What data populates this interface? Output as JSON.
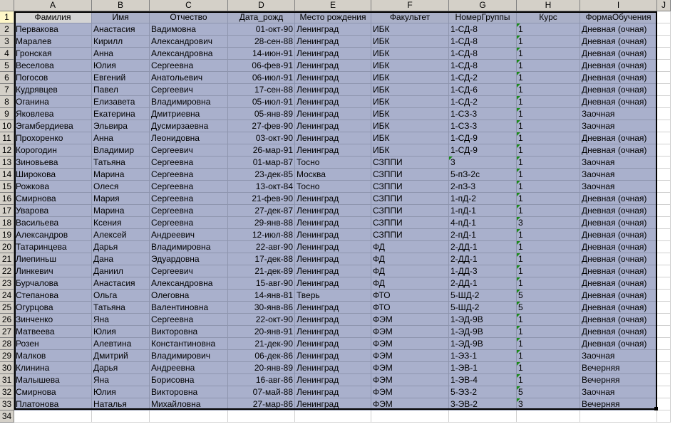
{
  "columns": [
    "A",
    "B",
    "C",
    "D",
    "E",
    "F",
    "G",
    "H",
    "I",
    "J"
  ],
  "headers": [
    "Фамилия",
    "Имя",
    "Отчество",
    "Дата_рожд",
    "Место рождения",
    "Факультет",
    "НомерГруппы",
    "Курс",
    "ФормаОбучения"
  ],
  "row_numbers": [
    "1",
    "2",
    "3",
    "4",
    "5",
    "6",
    "7",
    "8",
    "9",
    "10",
    "11",
    "12",
    "13",
    "14",
    "15",
    "16",
    "17",
    "18",
    "19",
    "20",
    "21",
    "22",
    "23",
    "24",
    "25",
    "26",
    "27",
    "28",
    "29",
    "30",
    "31",
    "32",
    "33",
    "34"
  ],
  "rows": [
    [
      "Первакова",
      "Анастасия",
      "Вадимовна",
      "01-окт-90",
      "Ленинград",
      "ИБК",
      "1-СД-8",
      "1",
      "Дневная (очная)"
    ],
    [
      "Маралев",
      "Кирилл",
      "Александрович",
      "28-сен-88",
      "Ленинград",
      "ИБК",
      "1-СД-8",
      "1",
      "Дневная (очная)"
    ],
    [
      "Гронская",
      "Анна",
      "Александровна",
      "14-июн-91",
      "Ленинград",
      "ИБК",
      "1-СД-8",
      "1",
      "Дневная (очная)"
    ],
    [
      "Веселова",
      "Юлия",
      "Сергеевна",
      "06-фев-91",
      "Ленинград",
      "ИБК",
      "1-СД-8",
      "1",
      "Дневная (очная)"
    ],
    [
      "Погосов",
      "Евгений",
      "Анатольевич",
      "06-июл-91",
      "Ленинград",
      "ИБК",
      "1-СД-2",
      "1",
      "Дневная (очная)"
    ],
    [
      "Кудрявцев",
      "Павел",
      "Сергеевич",
      "17-сен-88",
      "Ленинград",
      "ИБК",
      "1-СД-6",
      "1",
      "Дневная (очная)"
    ],
    [
      "Оганина",
      "Елизавета",
      "Владимировна",
      "05-июл-91",
      "Ленинград",
      "ИБК",
      "1-СД-2",
      "1",
      "Дневная (очная)"
    ],
    [
      "Яковлева",
      "Екатерина",
      "Дмитриевна",
      "05-янв-89",
      "Ленинград",
      "ИБК",
      "1-СЗ-3",
      "1",
      "Заочная"
    ],
    [
      "Эгамбердиева",
      "Эльвира",
      "Дусмирзаевна",
      "27-фев-90",
      "Ленинград",
      "ИБК",
      "1-СЗ-3",
      "1",
      "Заочная"
    ],
    [
      "Прохоренко",
      "Анна",
      "Леонидовна",
      "03-окт-90",
      "Ленинград",
      "ИБК",
      "1-СД-9",
      "1",
      "Дневная (очная)"
    ],
    [
      "Корогодин",
      "Владимир",
      "Сергеевич",
      "26-мар-91",
      "Ленинград",
      "ИБК",
      "1-СД-9",
      "1",
      "Дневная (очная)"
    ],
    [
      "Зиновьева",
      "Татьяна",
      "Сергеевна",
      "01-мар-87",
      "Тосно",
      "СЗППИ",
      "3",
      "1",
      "Заочная"
    ],
    [
      "Широкова",
      "Марина",
      "Сергеевна",
      "23-дек-85",
      "Москва",
      "СЗППИ",
      "5-пЗ-2с",
      "1",
      "Заочная"
    ],
    [
      "Рожкова",
      "Олеся",
      "Сергеевна",
      "13-окт-84",
      "Тосно",
      "СЗППИ",
      "2-пЗ-3",
      "1",
      "Заочная"
    ],
    [
      "Смирнова",
      "Мария",
      "Сергеевна",
      "21-фев-90",
      "Ленинград",
      "СЗППИ",
      "1-пД-2",
      "1",
      "Дневная (очная)"
    ],
    [
      "Уварова",
      "Марина",
      "Сергеевна",
      "27-дек-87",
      "Ленинград",
      "СЗППИ",
      "1-пД-1",
      "1",
      "Дневная (очная)"
    ],
    [
      "Васильева",
      "Ксения",
      "Сергеевна",
      "29-янв-88",
      "Ленинград",
      "СЗППИ",
      "4-пД-1",
      "3",
      "Дневная (очная)"
    ],
    [
      "Александров",
      "Алексей",
      "Андреевич",
      "12-июл-88",
      "Ленинград",
      "СЗППИ",
      "2-пД-1",
      "1",
      "Дневная (очная)"
    ],
    [
      "Татаринцева",
      "Дарья",
      "Владимировна",
      "22-авг-90",
      "Ленинград",
      "ФД",
      "2-ДД-1",
      "1",
      "Дневная (очная)"
    ],
    [
      "Лиепиньш",
      "Дана",
      "Эдуардовна",
      "17-дек-88",
      "Ленинград",
      "ФД",
      "2-ДД-1",
      "1",
      "Дневная (очная)"
    ],
    [
      "Линкевич",
      "Даниил",
      "Сергеевич",
      "21-дек-89",
      "Ленинград",
      "ФД",
      "1-ДД-3",
      "1",
      "Дневная (очная)"
    ],
    [
      "Бурчалова",
      "Анастасия",
      "Александровна",
      "15-авг-90",
      "Ленинград",
      "ФД",
      "2-ДД-1",
      "1",
      "Дневная (очная)"
    ],
    [
      "Степанова",
      "Ольга",
      "Олеговна",
      "14-янв-81",
      "Тверь",
      "ФТО",
      "5-ШД-2",
      "5",
      "Дневная (очная)"
    ],
    [
      "Огурцова",
      "Татьяна",
      "Валентиновна",
      "30-янв-86",
      "Ленинград",
      "ФТО",
      "5-ШД-2",
      "5",
      "Дневная (очная)"
    ],
    [
      "Зинченко",
      "Яна",
      "Сергеевна",
      "22-окт-90",
      "Ленинград",
      "ФЭМ",
      "1-ЭД-9В",
      "1",
      "Дневная (очная)"
    ],
    [
      "Матвеева",
      "Юлия",
      "Викторовна",
      "20-янв-91",
      "Ленинград",
      "ФЭМ",
      "1-ЭД-9В",
      "1",
      "Дневная (очная)"
    ],
    [
      "Розен",
      "Алевтина",
      "Константиновна",
      "21-дек-90",
      "Ленинград",
      "ФЭМ",
      "1-ЭД-9В",
      "1",
      "Дневная (очная)"
    ],
    [
      "Малков",
      "Дмитрий",
      "Владимирович",
      "06-дек-86",
      "Ленинград",
      "ФЭМ",
      "1-ЭЗ-1",
      "1",
      "Заочная"
    ],
    [
      "Клинина",
      "Дарья",
      "Андреевна",
      "20-янв-89",
      "Ленинград",
      "ФЭМ",
      "1-ЭВ-1",
      "1",
      "Вечерняя"
    ],
    [
      "Малышева",
      "Яна",
      "Борисовна",
      "16-авг-86",
      "Ленинград",
      "ФЭМ",
      "1-ЭВ-4",
      "1",
      "Вечерняя"
    ],
    [
      "Смирнова",
      "Юлия",
      "Викторовна",
      "07-май-88",
      "Ленинград",
      "ФЭМ",
      "5-ЭЗ-2",
      "5",
      "Заочная"
    ],
    [
      "Платонова",
      "Наталья",
      "Михайловна",
      "27-мар-86",
      "Ленинград",
      "ФЭМ",
      "3-ЭВ-2",
      "3",
      "Вечерняя"
    ]
  ],
  "colors": {
    "selection": "#a9b0cc",
    "header_gray": "#d4d0c8",
    "number_marker": "#1a8a1a"
  }
}
